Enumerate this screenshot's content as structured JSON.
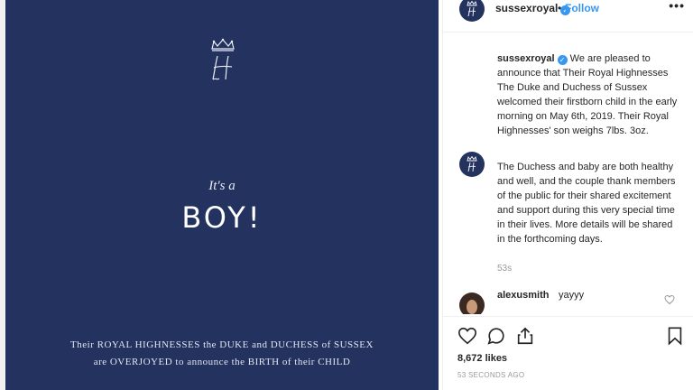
{
  "post_image": {
    "its_a": "It's a",
    "boy": "BOY!",
    "announcement_line1": "Their ROYAL HIGHNESSES the DUKE and DUCHESS of SUSSEX",
    "announcement_line2": "are OVERJOYED to announce the BIRTH of their CHILD",
    "background_color": "#23325f",
    "monogram_icon": "crown-monogram-icon"
  },
  "header": {
    "username": "sussexroyal",
    "verified_icon": "verified-badge-icon",
    "separator": "•",
    "follow_label": "Follow",
    "more_label": "•••"
  },
  "caption": {
    "username": "sussexroyal",
    "text": "We are pleased to announce that Their Royal Highnesses The Duke and Duchess of Sussex welcomed their firstborn child in the early morning on May 6th, 2019. Their Royal Highnesses' son weighs 7lbs. 3oz."
  },
  "caption2": {
    "text": "The Duchess and baby are both healthy and well, and the couple thank members of the public for their shared excitement and support during this very special time in their lives. More details will be shared in the forthcoming days.",
    "time": "53s"
  },
  "comment": {
    "username": "alexusmith",
    "text": "yayyy"
  },
  "actions": {
    "likes": "8,672 likes",
    "timestamp": "53 SECONDS AGO"
  },
  "colors": {
    "accent": "#3897f0",
    "navy": "#23325f"
  }
}
